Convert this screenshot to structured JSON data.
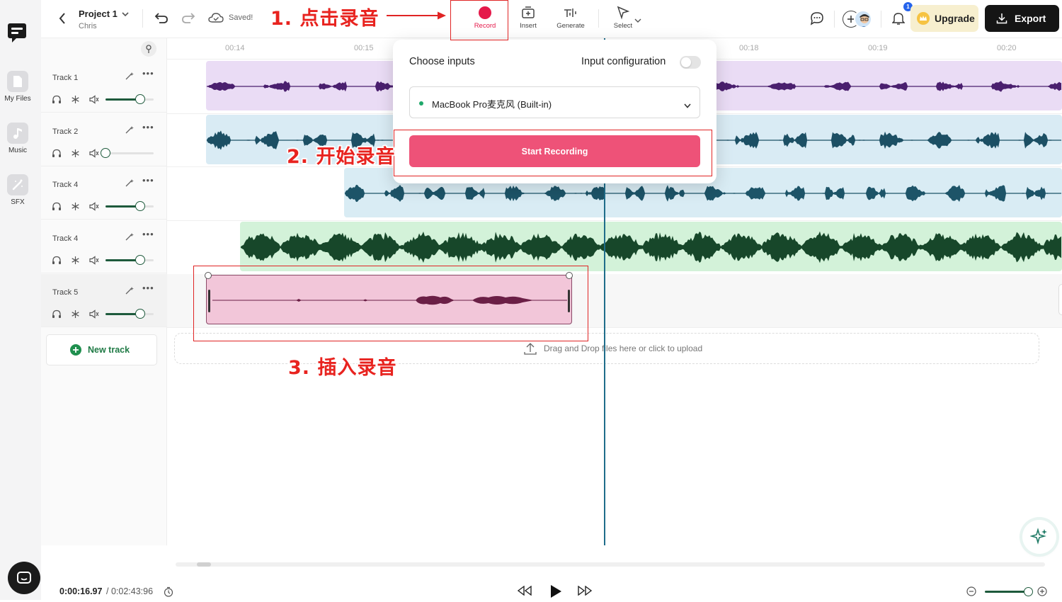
{
  "project": {
    "title": "Project 1",
    "owner": "Chris",
    "save_status": "Saved!"
  },
  "left_rail": {
    "items": [
      {
        "label": "My Files"
      },
      {
        "label": "Music"
      },
      {
        "label": "SFX"
      }
    ]
  },
  "toolbar": {
    "tools": [
      {
        "label": "Record"
      },
      {
        "label": "Insert"
      },
      {
        "label": "Generate"
      },
      {
        "label": "Select"
      }
    ],
    "upgrade_label": "Upgrade",
    "export_label": "Export",
    "notification_count": "1"
  },
  "timeline": {
    "ticks": [
      "00:14",
      "00:15",
      "00:18",
      "00:19",
      "00:20"
    ]
  },
  "tracks": [
    {
      "name": "Track 1",
      "volume": 0.72
    },
    {
      "name": "Track 2",
      "volume": 0.0
    },
    {
      "name": "Track 4",
      "volume": 0.72
    },
    {
      "name": "Track 4",
      "volume": 0.72
    },
    {
      "name": "Track 5",
      "volume": 0.72
    }
  ],
  "new_track_label": "New track",
  "upload_hint": "Drag and Drop files here or click to upload",
  "record_popup": {
    "choose_inputs_label": "Choose inputs",
    "input_config_label": "Input configuration",
    "selected_input": "MacBook Pro麦克风 (Built-in)",
    "start_button_label": "Start Recording"
  },
  "annotations": {
    "step1": "1. 点击录音",
    "step2": "2. 开始录音",
    "step3": "3. 插入录音"
  },
  "playback": {
    "current_time": "0:00:16.97",
    "total_time": "/ 0:02:43:96"
  },
  "colors": {
    "accent_green": "#1e5a3c",
    "record_red": "#e5194a",
    "start_button": "#ee5278",
    "annotation_red": "#e8231f",
    "track1_bg": "#eadcf5",
    "track1_wave": "#4a1f6e",
    "track2_bg": "#d9ebf4",
    "track2_wave": "#1c4f64",
    "track3_bg": "#d9ecf4",
    "track3_wave": "#1d5468",
    "track4_bg": "#d3f2d9",
    "track4_wave": "#17472a",
    "track5_bg": "#f2c6d9",
    "track5_wave": "#6b1f46"
  }
}
